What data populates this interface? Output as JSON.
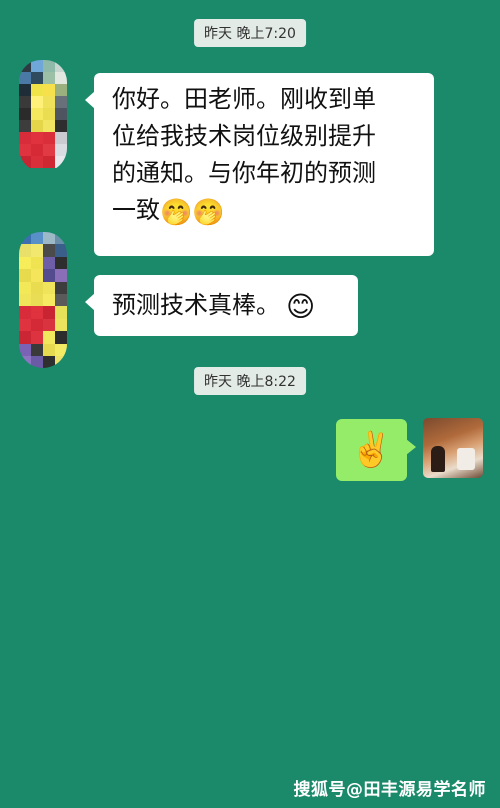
{
  "chat": {
    "timestamp_1": "昨天 晚上7:20",
    "msg1_line1": "你好。田老师。刚收到单",
    "msg1_line2": "位给我技术岗位级别提升",
    "msg1_line3": "的通知。与你年初的预测",
    "msg1_line4": "一致",
    "msg1_emojis": "🤭🤭",
    "msg2_text": "预测技术真棒。",
    "msg2_emoji": "😊",
    "timestamp_2": "昨天 晚上8:22",
    "msg3_emoji": "✌️"
  },
  "watermark": "搜狐号@田丰源易学名师",
  "colors": {
    "background": "#1b8a6b",
    "incoming_bubble": "#ffffff",
    "outgoing_bubble": "#95ec69",
    "timestamp_bg": "#e3ebe6"
  }
}
